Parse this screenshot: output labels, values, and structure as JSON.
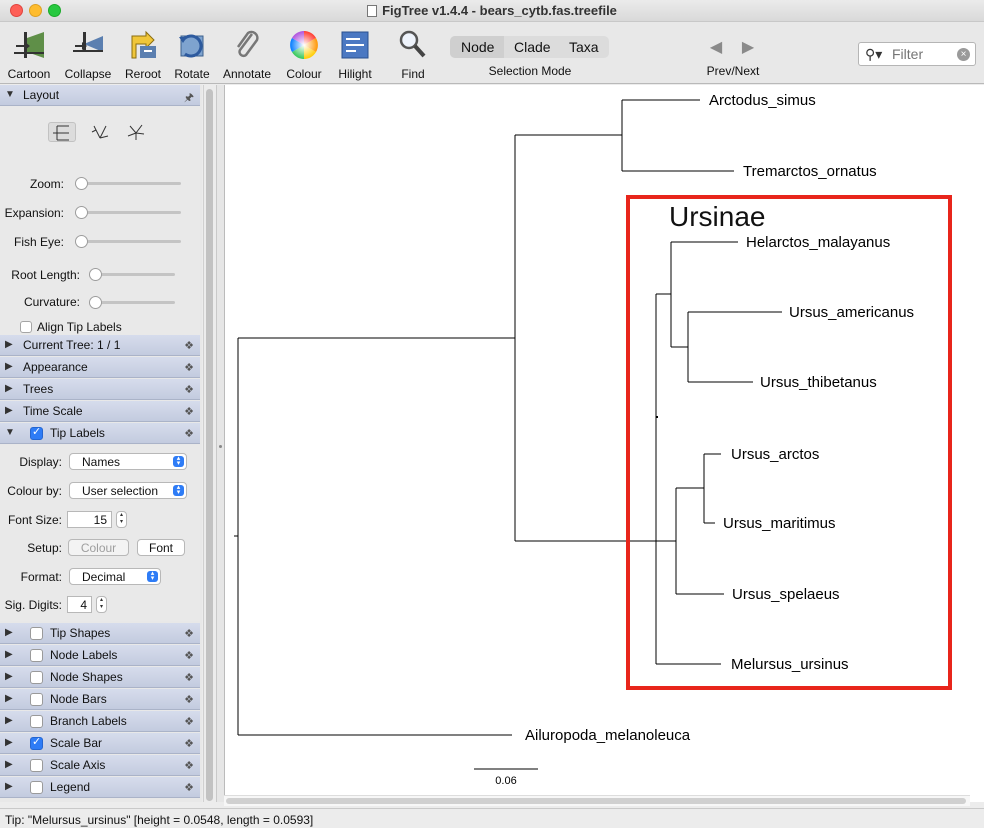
{
  "window": {
    "title": "FigTree v1.4.4 - bears_cytb.fas.treefile"
  },
  "toolbar": {
    "buttons": [
      {
        "label": "Cartoon",
        "icon": "cartoon-icon"
      },
      {
        "label": "Collapse",
        "icon": "collapse-icon"
      },
      {
        "label": "Reroot",
        "icon": "reroot-icon"
      },
      {
        "label": "Rotate",
        "icon": "rotate-icon"
      },
      {
        "label": "Annotate",
        "icon": "paperclip-icon"
      },
      {
        "label": "Colour",
        "icon": "color-wheel-icon"
      },
      {
        "label": "Hilight",
        "icon": "hilight-icon"
      },
      {
        "label": "Find",
        "icon": "magnifier-icon"
      }
    ],
    "selection_mode": {
      "options": [
        "Node",
        "Clade",
        "Taxa"
      ],
      "selected": "Node",
      "label": "Selection Mode"
    },
    "prev_next_label": "Prev/Next",
    "filter_placeholder": "Filter"
  },
  "sidebar": {
    "layout": {
      "title": "Layout",
      "zoom_label": "Zoom:",
      "expansion_label": "Expansion:",
      "fisheye_label": "Fish Eye:",
      "root_length_label": "Root Length:",
      "curvature_label": "Curvature:",
      "align_tip_labels": "Align Tip Labels",
      "slider_values": {
        "zoom": 0,
        "expansion": 0,
        "fisheye": 0,
        "root_length": 0,
        "curvature": 0
      }
    },
    "sections": [
      {
        "title": "Current Tree: 1 / 1",
        "checkbox": null
      },
      {
        "title": "Appearance",
        "checkbox": null
      },
      {
        "title": "Trees",
        "checkbox": null
      },
      {
        "title": "Time Scale",
        "checkbox": null
      },
      {
        "title": "Tip Labels",
        "checkbox": true
      }
    ],
    "tip_labels": {
      "display_label": "Display:",
      "display_value": "Names",
      "colour_by_label": "Colour by:",
      "colour_by_value": "User selection",
      "font_size_label": "Font Size:",
      "font_size_value": "15",
      "setup_label": "Setup:",
      "colour_button": "Colour",
      "font_button": "Font",
      "format_label": "Format:",
      "format_value": "Decimal",
      "sig_digits_label": "Sig. Digits:",
      "sig_digits_value": "4"
    },
    "lower_sections": [
      {
        "title": "Tip Shapes",
        "checkbox": false
      },
      {
        "title": "Node Labels",
        "checkbox": false
      },
      {
        "title": "Node Shapes",
        "checkbox": false
      },
      {
        "title": "Node Bars",
        "checkbox": false
      },
      {
        "title": "Branch Labels",
        "checkbox": false
      },
      {
        "title": "Scale Bar",
        "checkbox": true
      },
      {
        "title": "Scale Axis",
        "checkbox": false
      },
      {
        "title": "Legend",
        "checkbox": false
      }
    ]
  },
  "tree": {
    "tips": [
      "Arctodus_simus",
      "Tremarctos_ornatus",
      "Helarctos_malayanus",
      "Ursus_americanus",
      "Ursus_thibetanus",
      "Ursus_arctos",
      "Ursus_maritimus",
      "Ursus_spelaeus",
      "Melursus_ursinus",
      "Ailuropoda_melanoleuca"
    ],
    "annotation": {
      "text": "Ursinae",
      "color": "#e8251b"
    },
    "scale_bar_label": "0.06"
  },
  "status": {
    "text": "Tip: \"Melursus_ursinus\" [height = 0.0548, length = 0.0593]"
  }
}
